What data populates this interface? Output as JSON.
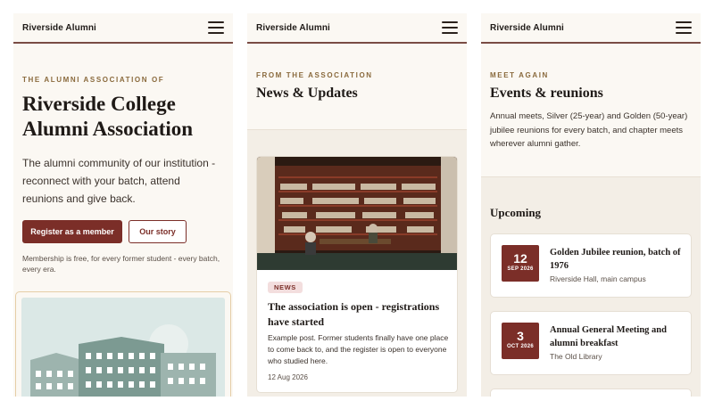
{
  "brand": "Riverside Alumni",
  "home": {
    "eyebrow": "THE ALUMNI ASSOCIATION OF",
    "title": "Riverside College Alumni Association",
    "lead": "The alumni community of our institution - reconnect with your batch, attend reunions and give back.",
    "register_label": "Register as a member",
    "story_label": "Our story",
    "fine_print": "Membership is free, for every former student - every batch, every era."
  },
  "news": {
    "eyebrow": "FROM THE ASSOCIATION",
    "title": "News & Updates",
    "post": {
      "tag": "NEWS",
      "title": "The association is open - registrations have started",
      "body": "Example post. Former students finally have one place to come back to, and the register is open to everyone who studied here.",
      "date": "12 Aug 2026"
    }
  },
  "events": {
    "eyebrow": "MEET AGAIN",
    "title": "Events & reunions",
    "intro": "Annual meets, Silver (25-year) and Golden (50-year) jubilee reunions for every batch, and chapter meets wherever alumni gather.",
    "upcoming_title": "Upcoming",
    "items": [
      {
        "day": "12",
        "month": "SEP 2026",
        "name": "Golden Jubilee reunion, batch of 1976",
        "place": "Riverside Hall, main campus"
      },
      {
        "day": "3",
        "month": "OCT 2026",
        "name": "Annual General Meeting and alumni breakfast",
        "place": "The Old Library"
      }
    ]
  },
  "colors": {
    "accent": "#7b2e28",
    "eyebrow": "#8a6a3d",
    "background": "#fbf8f3"
  },
  "icons": [
    "menu-icon"
  ]
}
